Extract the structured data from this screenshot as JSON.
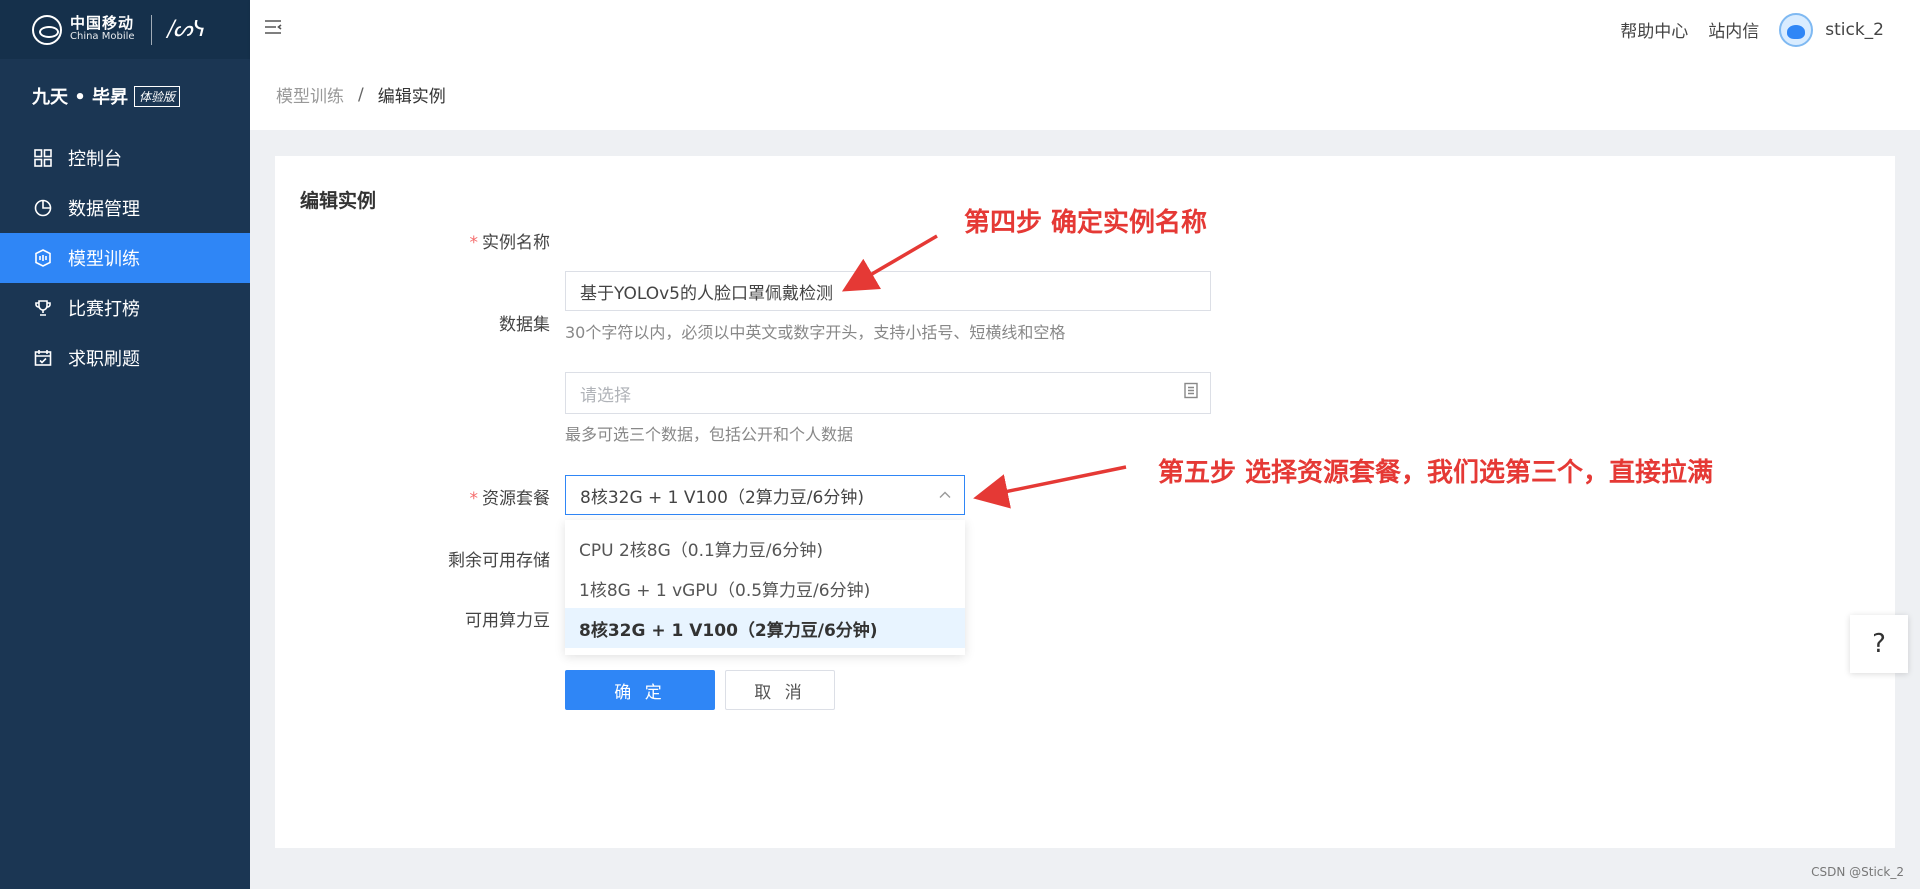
{
  "brand": {
    "logo_cn": "中国移动",
    "logo_en": "China Mobile",
    "sign": "/ᔕᓭ",
    "product_name": "九天 • 毕昇",
    "product_badge": "体验版"
  },
  "sidebar": {
    "items": [
      {
        "label": "控制台",
        "icon": "dashboard-grid-icon"
      },
      {
        "label": "数据管理",
        "icon": "pie-chart-icon"
      },
      {
        "label": "模型训练",
        "icon": "model-shield-icon",
        "active": true
      },
      {
        "label": "比赛打榜",
        "icon": "trophy-icon"
      },
      {
        "label": "求职刷题",
        "icon": "calendar-check-icon"
      }
    ]
  },
  "topbar": {
    "help_center": "帮助中心",
    "messages": "站内信",
    "username": "stick_2"
  },
  "breadcrumb": {
    "parent": "模型训练",
    "separator": "/",
    "current": "编辑实例"
  },
  "form": {
    "title": "编辑实例",
    "instance_name": {
      "label": "实例名称",
      "value": "基于YOLOv5的人脸口罩佩戴检测",
      "hint": "30个字符以内，必须以中英文或数字开头，支持小括号、短横线和空格"
    },
    "dataset": {
      "label": "数据集",
      "placeholder": "请选择",
      "hint": "最多可选三个数据，包括公开和个人数据"
    },
    "resource": {
      "label": "资源套餐",
      "value": "8核32G + 1 V100（2算力豆/6分钟)",
      "options": [
        "CPU 2核8G（0.1算力豆/6分钟)",
        "1核8G + 1 vGPU（0.5算力豆/6分钟)",
        "8核32G + 1 V100（2算力豆/6分钟)"
      ],
      "selected_index": 2
    },
    "storage_label": "剩余可用存储",
    "beans_label": "可用算力豆",
    "confirm_label": "确 定",
    "cancel_label": "取 消"
  },
  "annotations": {
    "step4": "第四步 确定实例名称",
    "step5": "第五步 选择资源套餐，我们选第三个，直接拉满"
  },
  "help_fab": "?",
  "watermark": "CSDN @Stick_2",
  "colors": {
    "sidebar_bg": "#1b3653",
    "accent": "#2f86f6",
    "annotation": "#e53935",
    "required": "#f56c6c"
  }
}
